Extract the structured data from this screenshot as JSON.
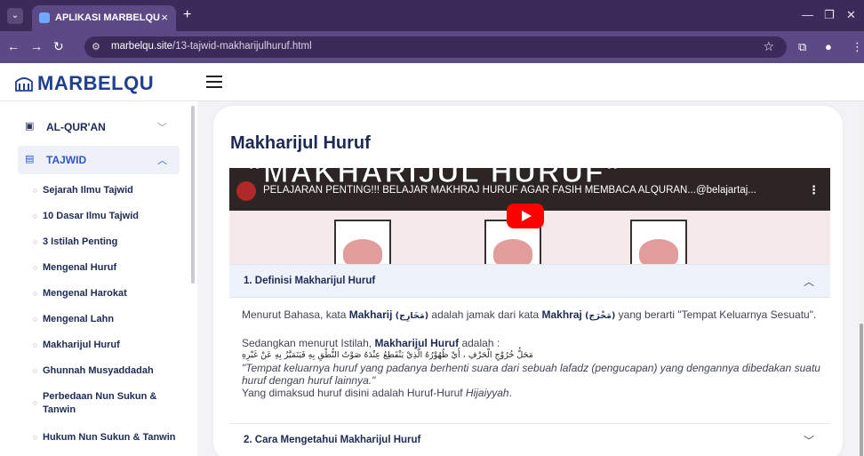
{
  "browser": {
    "tab_title": "APLIKASI MARBELQU",
    "url_domain": "marbelqu.site",
    "url_path": "/13-tajwid-makharijulhuruf.html"
  },
  "header": {
    "logo_text": "MARBELQU"
  },
  "sidebar": {
    "items": [
      {
        "label": "AL-QUR'AN"
      },
      {
        "label": "TAJWID"
      }
    ],
    "subitems": [
      "Sejarah Ilmu Tajwid",
      "10 Dasar Ilmu Tajwid",
      "3 Istilah Penting",
      "Mengenal Huruf",
      "Mengenal Harokat",
      "Mengenal Lahn",
      "Makharijul Huruf",
      "Ghunnah Musyaddadah",
      "Perbedaan Nun Sukun &",
      "Tanwin",
      "Hukum Nun Sukun & Tanwin"
    ]
  },
  "main": {
    "title": "Makharijul Huruf",
    "video": {
      "banner_text": "\"MAKHARIJUL HURUF\"",
      "caption": "PELAJARAN PENTING!!! BELAJAR MAKHRAJ HURUF AGAR FASIH MEMBACA ALQURAN...@belajartaj..."
    },
    "accordion": [
      {
        "title": "1. Definisi Makharijul Huruf",
        "p1_a": "Menurut Bahasa, kata ",
        "p1_b": "Makharij",
        "p1_c": " (مَخَارِج)",
        "p1_d": " adalah jamak dari kata ",
        "p1_e": "Makhraj",
        "p1_f": " (مَخْرَج)",
        "p1_g": " yang berarti \"Tempat Keluarnya Sesuatu\".",
        "p2_a": "Sedangkan menurut Istilah, ",
        "p2_b": "Makharijul Huruf",
        "p2_c": " adalah :",
        "arabic": "مَحَلُّ خُرُوْجِ الْحَرْفِ ، أَيْ ظُهُوْرُهُ الَّذِيْ يَنْقَطِعُ عِنْدَهُ صَوْتُ النُّطْقِ بِهِ فَيَتَمَيَّزُ بِهِ عَنْ غَيْرِهِ",
        "quote1": "\"Tempat keluarnya huruf yang padanya berhenti suara dari sebuah lafadz (pengucapan) yang dengannya dibedakan suatu",
        "quote2": "huruf dengan huruf lainnya.\"",
        "p3_a": "Yang dimaksud huruf disini adalah Huruf-Huruf ",
        "p3_b": "Hijaiyyah",
        "p3_c": "."
      },
      {
        "title": "2. Cara Mengetahui Makharijul Huruf"
      }
    ]
  }
}
